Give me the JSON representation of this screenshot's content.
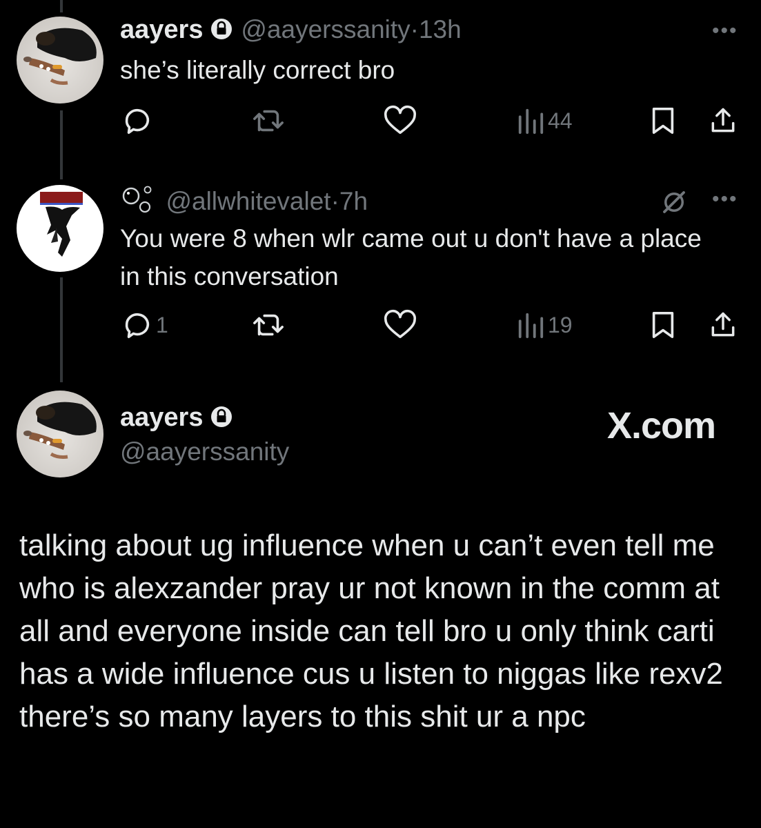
{
  "tweet1": {
    "name": "aayers",
    "handle": "@aayerssanity",
    "time": "13h",
    "text": "she’s literally correct bro",
    "replies": "",
    "views": "44"
  },
  "tweet2": {
    "handle": "@allwhitevalet",
    "time": "7h",
    "text": "You were 8 when wlr came out u don't have a place in this conversation",
    "replies": "1",
    "views": "19"
  },
  "main_tweet": {
    "name": "aayers",
    "handle": "@aayerssanity",
    "watermark": "X.com",
    "text": "talking about ug influence when u can’t even tell me who is alexzander pray ur not known in the comm at all and everyone inside can tell bro u only think carti has a wide influence cus u listen to niggas like rexv2 there’s so many layers to this shit ur a npc"
  },
  "separator": "·",
  "colors": {
    "background": "#000000",
    "text": "#e7e9ea",
    "muted": "#71767b",
    "line": "#333639"
  }
}
